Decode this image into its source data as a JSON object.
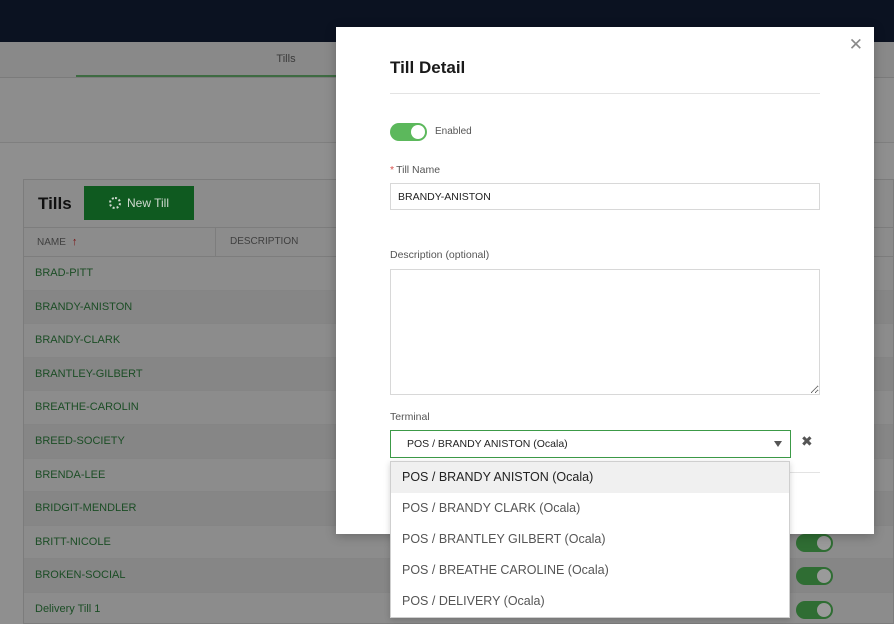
{
  "page": {
    "tab_label": "Tills",
    "panel_title": "Tills",
    "new_till_label": "New Till",
    "columns": [
      "NAME",
      "DESCRIPTION"
    ],
    "rows": [
      {
        "name": "BRAD-PITT",
        "enabled": null
      },
      {
        "name": "BRANDY-ANISTON",
        "enabled": null
      },
      {
        "name": "BRANDY-CLARK",
        "enabled": null
      },
      {
        "name": "BRANTLEY-GILBERT",
        "enabled": null
      },
      {
        "name": "BREATHE-CAROLIN",
        "enabled": null
      },
      {
        "name": "BREED-SOCIETY",
        "enabled": null
      },
      {
        "name": "BRENDA-LEE",
        "enabled": null
      },
      {
        "name": "BRIDGIT-MENDLER",
        "enabled": null
      },
      {
        "name": "BRITT-NICOLE",
        "enabled": true
      },
      {
        "name": "BROKEN-SOCIAL",
        "enabled": true
      },
      {
        "name": "Delivery Till 1",
        "enabled": true
      }
    ]
  },
  "modal": {
    "title": "Till Detail",
    "enabled": true,
    "enabled_label": "Enabled",
    "required_mark": "*",
    "till_name_label": "Till Name",
    "till_name_value": "BRANDY-ANISTON",
    "description_label": "Description (optional)",
    "description_value": "",
    "terminal_label": "Terminal",
    "terminal_value": "POS / BRANDY ANISTON (Ocala)"
  },
  "dropdown": {
    "options": [
      "POS / BRANDY ANISTON (Ocala)",
      "POS / BRANDY CLARK (Ocala)",
      "POS / BRANTLEY GILBERT (Ocala)",
      "POS / BREATHE CAROLINE (Ocala)",
      "POS / DELIVERY (Ocala)"
    ],
    "highlighted_index": 0
  },
  "colors": {
    "accent_green": "#5cb85c",
    "select_border": "#3c9a47",
    "header_bg": "#0b1221"
  }
}
